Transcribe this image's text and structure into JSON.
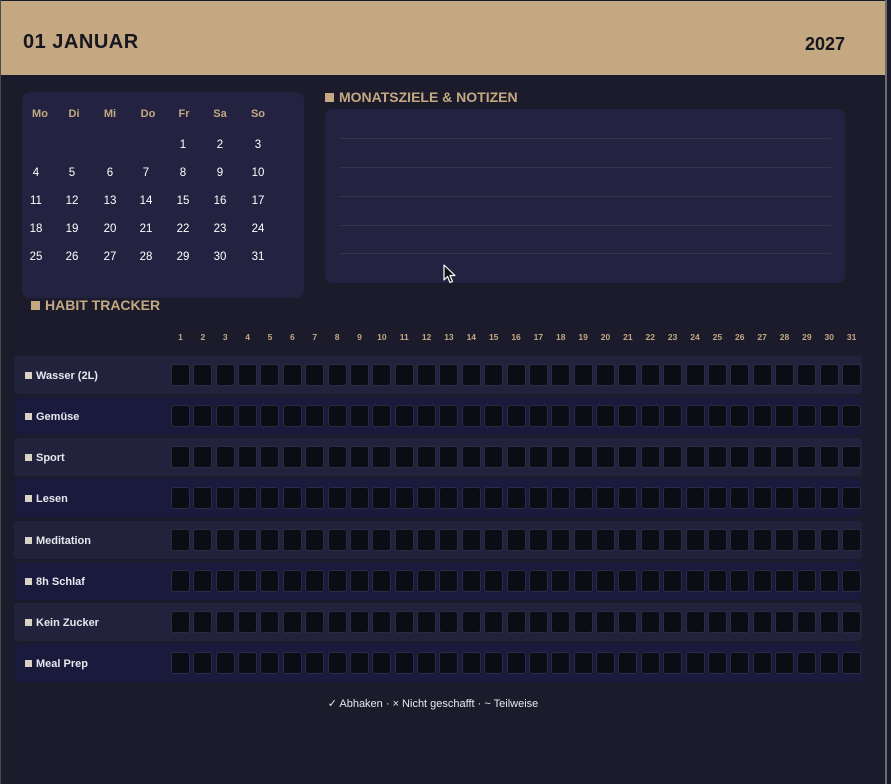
{
  "header": {
    "title": "01  JANUAR",
    "year": "2027"
  },
  "calendar": {
    "weekdays": [
      "Mo",
      "Di",
      "Mi",
      "Do",
      "Fr",
      "Sa",
      "So"
    ],
    "weeks": [
      [
        "",
        "",
        "",
        "",
        "1",
        "2",
        "3"
      ],
      [
        "4",
        "5",
        "6",
        "7",
        "8",
        "9",
        "10"
      ],
      [
        "11",
        "12",
        "13",
        "14",
        "15",
        "16",
        "17"
      ],
      [
        "18",
        "19",
        "20",
        "21",
        "22",
        "23",
        "24"
      ],
      [
        "25",
        "26",
        "27",
        "28",
        "29",
        "30",
        "31"
      ]
    ]
  },
  "notes": {
    "title": "MONATSZIELE & NOTIZEN"
  },
  "tracker": {
    "title": "HABIT TRACKER",
    "days": [
      "1",
      "2",
      "3",
      "4",
      "5",
      "6",
      "7",
      "8",
      "9",
      "10",
      "11",
      "12",
      "13",
      "14",
      "15",
      "16",
      "17",
      "18",
      "19",
      "20",
      "21",
      "22",
      "23",
      "24",
      "25",
      "26",
      "27",
      "28",
      "29",
      "30",
      "31"
    ],
    "habits": [
      "Wasser (2L)",
      "Gemüse",
      "Sport",
      "Lesen",
      "Meditation",
      "8h Schlaf",
      "Kein Zucker",
      "Meal Prep"
    ]
  },
  "legend": "✓ Abhaken · × Nicht geschafft · ~ Teilweise",
  "colors": {
    "accent": "#c3a882",
    "background": "#1b1b2c",
    "panel": "#232341",
    "cell": "#0c0c14"
  }
}
